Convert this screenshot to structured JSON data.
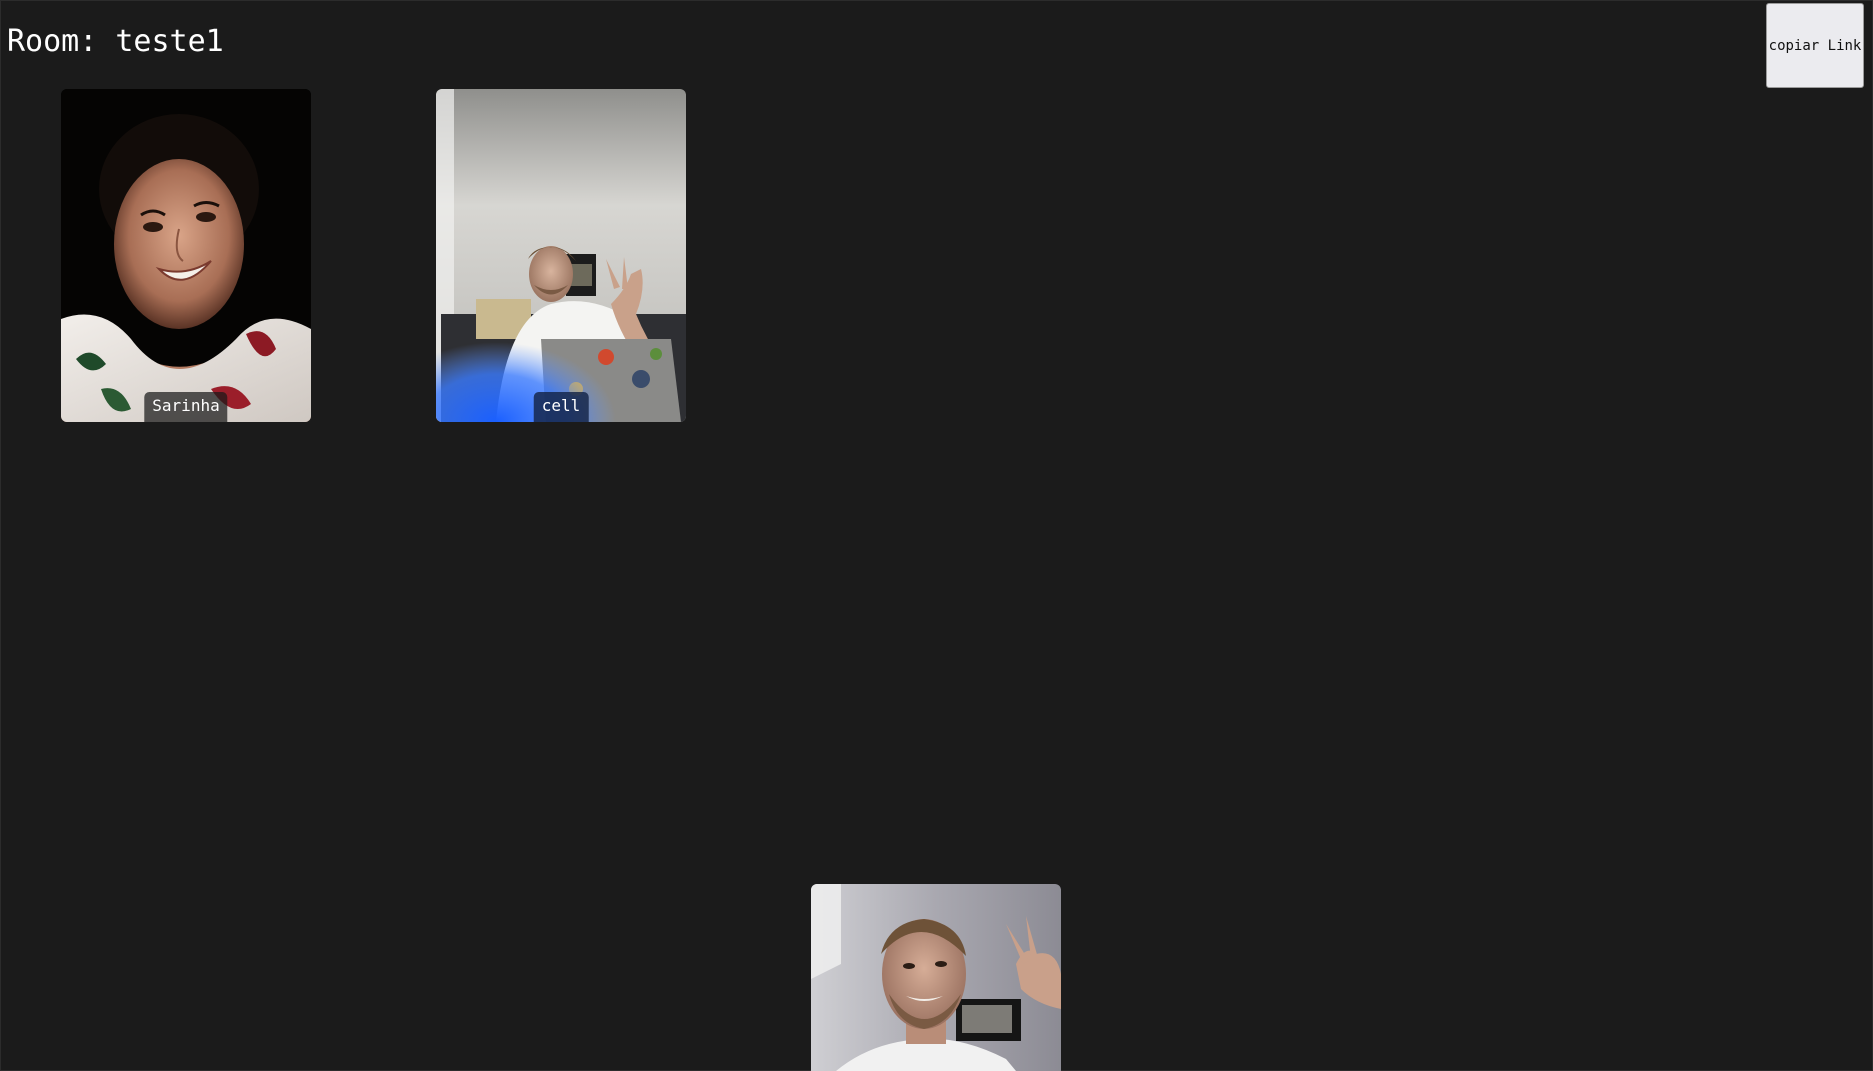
{
  "room": {
    "prefix": "Room:",
    "name": "teste1",
    "title": "Room: teste1"
  },
  "actions": {
    "copy_link_label": "copiar Link"
  },
  "participants": [
    {
      "name": "Sarinha"
    },
    {
      "name": "cell"
    }
  ],
  "local_video": {
    "name": ""
  },
  "colors": {
    "background": "#1b1b1b",
    "button_background": "#ebebef",
    "label_background": "#191919",
    "label_background_alt": "#142346",
    "text": "#ffffff"
  }
}
